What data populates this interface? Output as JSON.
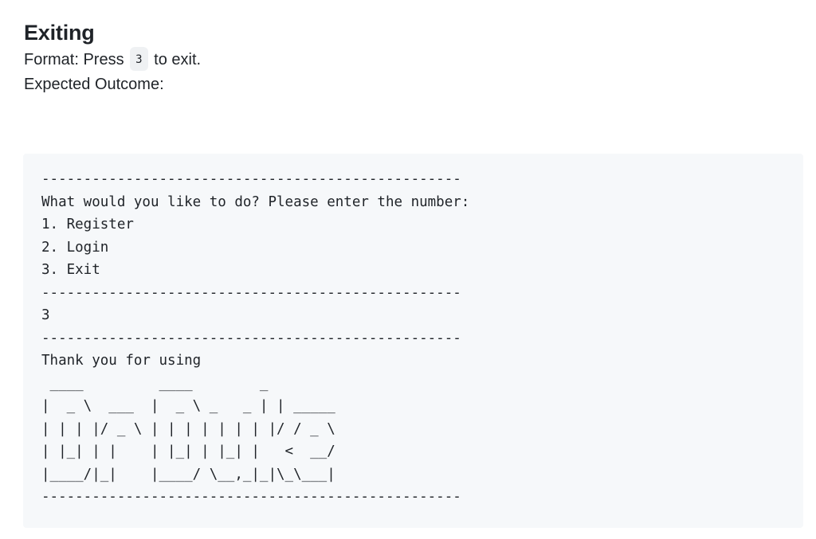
{
  "heading": "Exiting",
  "format_line": {
    "prefix": "Format: Press",
    "key": "3",
    "suffix": "to exit."
  },
  "expected_label": "Expected Outcome:",
  "code_block": {
    "text": "--------------------------------------------------\nWhat would you like to do? Please enter the number:\n1. Register\n2. Login\n3. Exit\n--------------------------------------------------\n3\n--------------------------------------------------\nThank you for using\n ____         ____        _\n|  _ \\  ___  |  _ \\ _   _ | | _____\n| | | |/ _ \\ | | | | | | | |/ / _ \\\n| |_| | |    | |_| | |_| |   <  __/\n|____/|_|    |____/ \\__,_|_|\\_\\___|\n--------------------------------------------------"
  }
}
